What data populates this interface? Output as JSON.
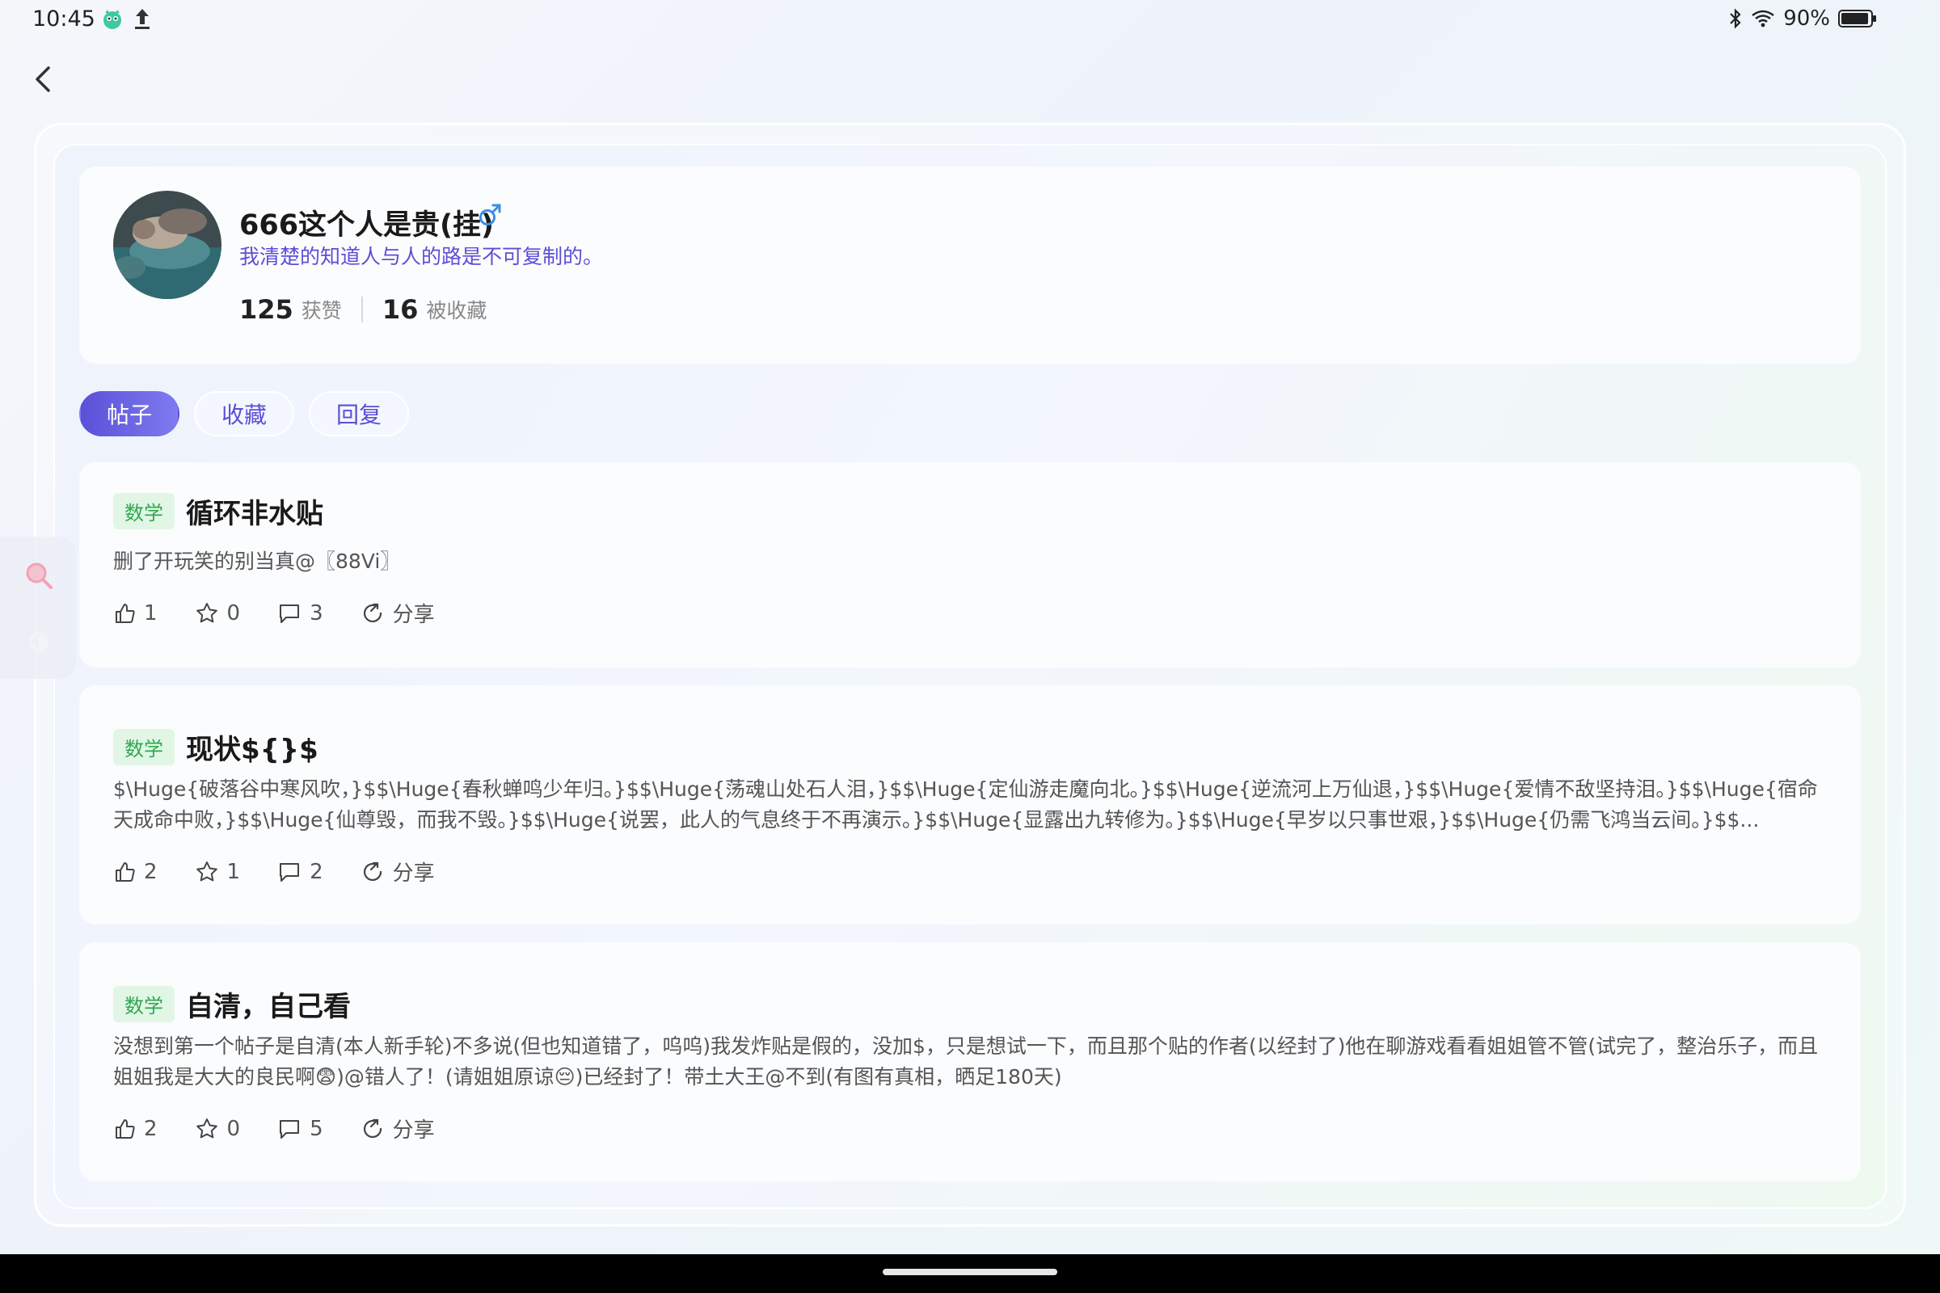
{
  "status_bar": {
    "time": "10:45",
    "battery": "90%",
    "icons": [
      "app-notification-icon",
      "upload-icon",
      "bluetooth-icon",
      "wifi-icon",
      "battery-icon"
    ]
  },
  "profile": {
    "username": "666这个人是贵(挂)",
    "gender_icon": "male-icon",
    "bio": "我清楚的知道人与人的路是不可复制的。",
    "likes_count": "125",
    "likes_label": "获赞",
    "favorited_count": "16",
    "favorited_label": "被收藏"
  },
  "tabs": [
    {
      "label": "帖子",
      "active": true
    },
    {
      "label": "收藏",
      "active": false
    },
    {
      "label": "回复",
      "active": false
    }
  ],
  "posts": [
    {
      "tag": "数学",
      "title": "循环非水贴",
      "body": "删了开玩笑的别当真@〖88Vi〗",
      "likes": "1",
      "stars": "0",
      "comments": "3",
      "share_label": "分享"
    },
    {
      "tag": "数学",
      "title": "现状${}$",
      "body": "$\\Huge{破落谷中寒风吹，}$$\\Huge{春秋蝉鸣少年归。}$$\\Huge{荡魂山处石人泪，}$$\\Huge{定仙游走魔向北。}$$\\Huge{逆流河上万仙退，}$$\\Huge{爱情不敌坚持泪。}$$\\Huge{宿命天成命中败，}$$\\Huge{仙尊毁，而我不毁。}$$\\Huge{说罢，此人的气息终于不再演示。}$$\\Huge{显露出九转修为。}$$\\Huge{早岁以只事世艰，}$$\\Huge{仍需飞鸿当云间。}$$...",
      "likes": "2",
      "stars": "1",
      "comments": "2",
      "share_label": "分享"
    },
    {
      "tag": "数学",
      "title": "自清，自己看",
      "body": "没想到第一个帖子是自清(本人新手轮)不多说(但也知道错了，呜呜)我发炸贴是假的，没加$，只是想试一下，而且那个贴的作者(以经封了)他在聊游戏看看姐姐管不管(试完了，整治乐子，而且姐姐我是大大的良民啊😨)@错人了！(请姐姐原谅😔)已经封了！带土大王@不到(有图有真相，晒足180天)",
      "likes": "2",
      "stars": "0",
      "comments": "5",
      "share_label": "分享"
    }
  ],
  "colors": {
    "accent": "#5a4fd6",
    "tag_bg": "#e2f6e6",
    "tag_text": "#2fa84f"
  }
}
